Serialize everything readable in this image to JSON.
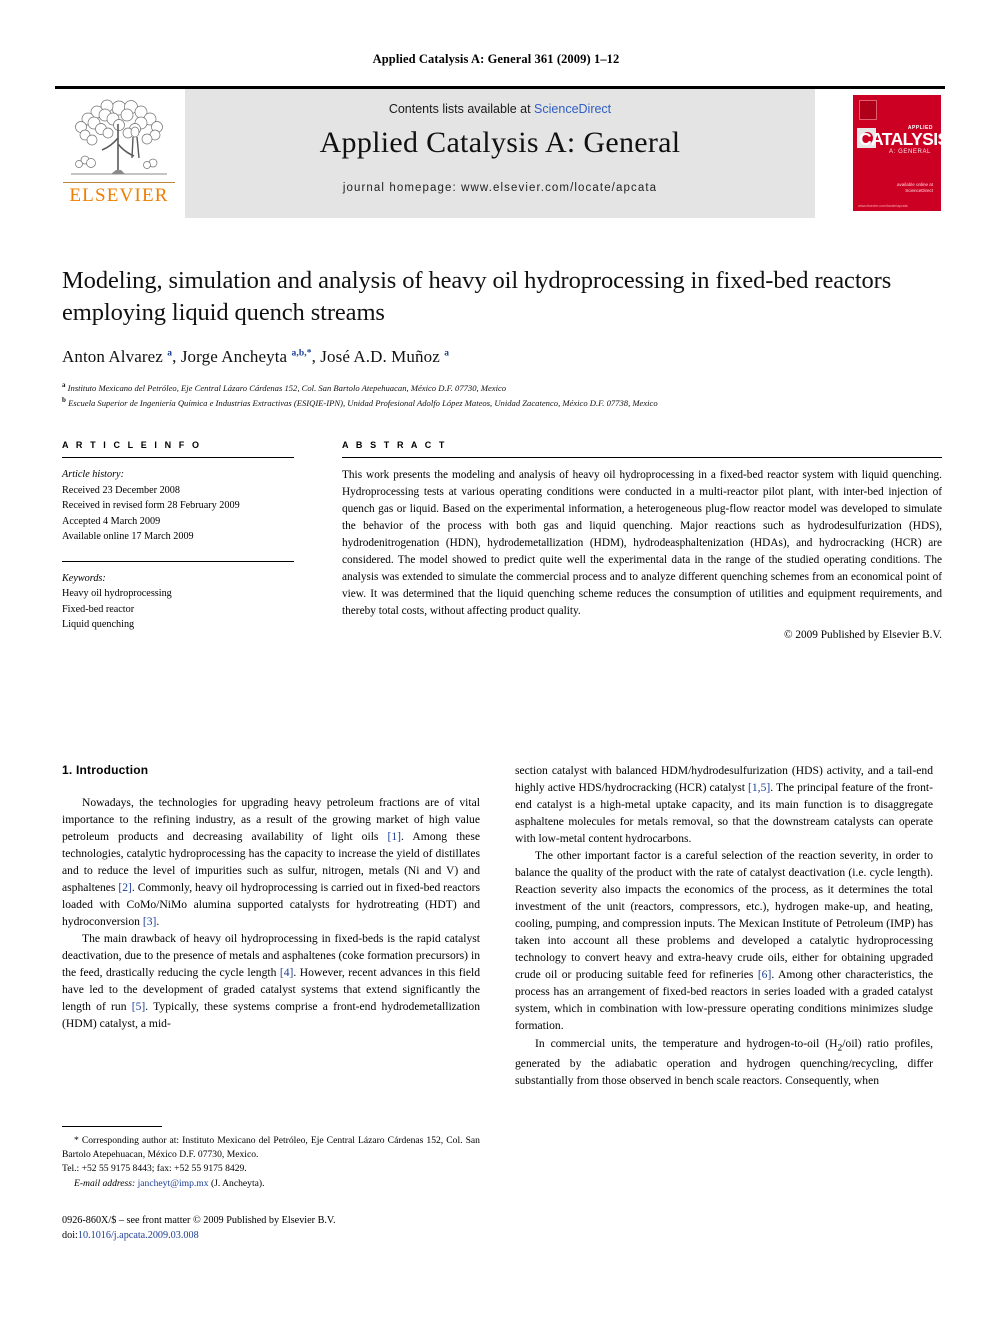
{
  "running_head": "Applied Catalysis A: General 361 (2009) 1–12",
  "masthead": {
    "contents_prefix": "Contents lists available at ",
    "contents_link": "ScienceDirect",
    "journal_title": "Applied Catalysis A: General",
    "homepage": "journal homepage: www.elsevier.com/locate/apcata",
    "publisher_logo_word": "ELSEVIER",
    "cover": {
      "applied": "APPLIED",
      "catalysis": "CATALYSIS",
      "a_general": "A: GENERAL",
      "sciencedirect": "available online at ScienceDirect",
      "bottom": "www.elsevier.com/locate/apcata"
    }
  },
  "article": {
    "title": "Modeling, simulation and analysis of heavy oil hydroprocessing in fixed-bed reactors employing liquid quench streams",
    "authors_html": "Anton Alvarez <sup>a</sup>, Jorge Ancheyta <sup>a,b,*</sup>, José A.D. Muñoz <sup>a</sup>",
    "affiliation_a": "Instituto Mexicano del Petróleo, Eje Central Lázaro Cárdenas 152, Col. San Bartolo Atepehuacan, México D.F. 07730, Mexico",
    "affiliation_b": "Escuela Superior de Ingeniería Química e Industrias Extractivas (ESIQIE-IPN), Unidad Profesional Adolfo López Mateos, Unidad Zacatenco, México D.F. 07738, Mexico"
  },
  "article_info": {
    "heading": "A R T I C L E   I N F O",
    "history_label": "Article history:",
    "history": [
      "Received 23 December 2008",
      "Received in revised form 28 February 2009",
      "Accepted 4 March 2009",
      "Available online 17 March 2009"
    ],
    "keywords_label": "Keywords:",
    "keywords": [
      "Heavy oil hydroprocessing",
      "Fixed-bed reactor",
      "Liquid quenching"
    ]
  },
  "abstract": {
    "heading": "A B S T R A C T",
    "text": "This work presents the modeling and analysis of heavy oil hydroprocessing in a fixed-bed reactor system with liquid quenching. Hydroprocessing tests at various operating conditions were conducted in a multi-reactor pilot plant, with inter-bed injection of quench gas or liquid. Based on the experimental information, a heterogeneous plug-flow reactor model was developed to simulate the behavior of the process with both gas and liquid quenching. Major reactions such as hydrodesulfurization (HDS), hydrodenitrogenation (HDN), hydrodemetallization (HDM), hydrodeasphaltenization (HDAs), and hydrocracking (HCR) are considered. The model showed to predict quite well the experimental data in the range of the studied operating conditions. The analysis was extended to simulate the commercial process and to analyze different quenching schemes from an economical point of view. It was determined that the liquid quenching scheme reduces the consumption of utilities and equipment requirements, and thereby total costs, without affecting product quality.",
    "copyright": "© 2009 Published by Elsevier B.V."
  },
  "body": {
    "section_heading": "1. Introduction",
    "left_paragraphs": [
      "Nowadays, the technologies for upgrading heavy petroleum fractions are of vital importance to the refining industry, as a result of the growing market of high value petroleum products and decreasing availability of light oils [1]. Among these technologies, catalytic hydroprocessing has the capacity to increase the yield of distillates and to reduce the level of impurities such as sulfur, nitrogen, metals (Ni and V) and asphaltenes [2]. Commonly, heavy oil hydroprocessing is carried out in fixed-bed reactors loaded with CoMo/NiMo alumina supported catalysts for hydrotreating (HDT) and hydroconversion [3].",
      "The main drawback of heavy oil hydroprocessing in fixed-beds is the rapid catalyst deactivation, due to the presence of metals and asphaltenes (coke formation precursors) in the feed, drastically reducing the cycle length [4]. However, recent advances in this field have led to the development of graded catalyst systems that extend significantly the length of run [5]. Typically, these systems comprise a front-end hydrodemetallization (HDM) catalyst, a mid-"
    ],
    "right_paragraphs": [
      "section catalyst with balanced HDM/hydrodesulfurization (HDS) activity, and a tail-end highly active HDS/hydrocracking (HCR) catalyst [1,5]. The principal feature of the front-end catalyst is a high-metal uptake capacity, and its main function is to disaggregate asphaltene molecules for metals removal, so that the downstream catalysts can operate with low-metal content hydrocarbons.",
      "The other important factor is a careful selection of the reaction severity, in order to balance the quality of the product with the rate of catalyst deactivation (i.e. cycle length). Reaction severity also impacts the economics of the process, as it determines the total investment of the unit (reactors, compressors, etc.), hydrogen make-up, and heating, cooling, pumping, and compression inputs. The Mexican Institute of Petroleum (IMP) has taken into account all these problems and developed a catalytic hydroprocessing technology to convert heavy and extra-heavy crude oils, either for obtaining upgraded crude oil or producing suitable feed for refineries [6]. Among other characteristics, the process has an arrangement of fixed-bed reactors in series loaded with a graded catalyst system, which in combination with low-pressure operating conditions minimizes sludge formation.",
      "In commercial units, the temperature and hydrogen-to-oil (H2/oil) ratio profiles, generated by the adiabatic operation and hydrogen quenching/recycling, differ substantially from those observed in bench scale reactors. Consequently, when"
    ]
  },
  "footnote": {
    "marker": "*",
    "corresponding": "Corresponding author at: Instituto Mexicano del Petróleo, Eje Central Lázaro Cárdenas 152, Col. San Bartolo Atepehuacan, México D.F. 07730, Mexico.",
    "tel": "Tel.: +52 55 9175 8443; fax: +52 55 9175 8429.",
    "email_label": "E-mail address:",
    "email": "jancheyt@imp.mx",
    "email_owner": "(J. Ancheyta)."
  },
  "imprint": {
    "issn_line": "0926-860X/$ – see front matter © 2009 Published by Elsevier B.V.",
    "doi_label": "doi:",
    "doi": "10.1016/j.apcata.2009.03.008"
  },
  "colors": {
    "link": "#1c3f94",
    "sciencedirect": "#2f5ec4",
    "elsevier_orange": "#f07d00",
    "cover_red": "#cc0022",
    "band_gray": "#e4e4e4"
  }
}
